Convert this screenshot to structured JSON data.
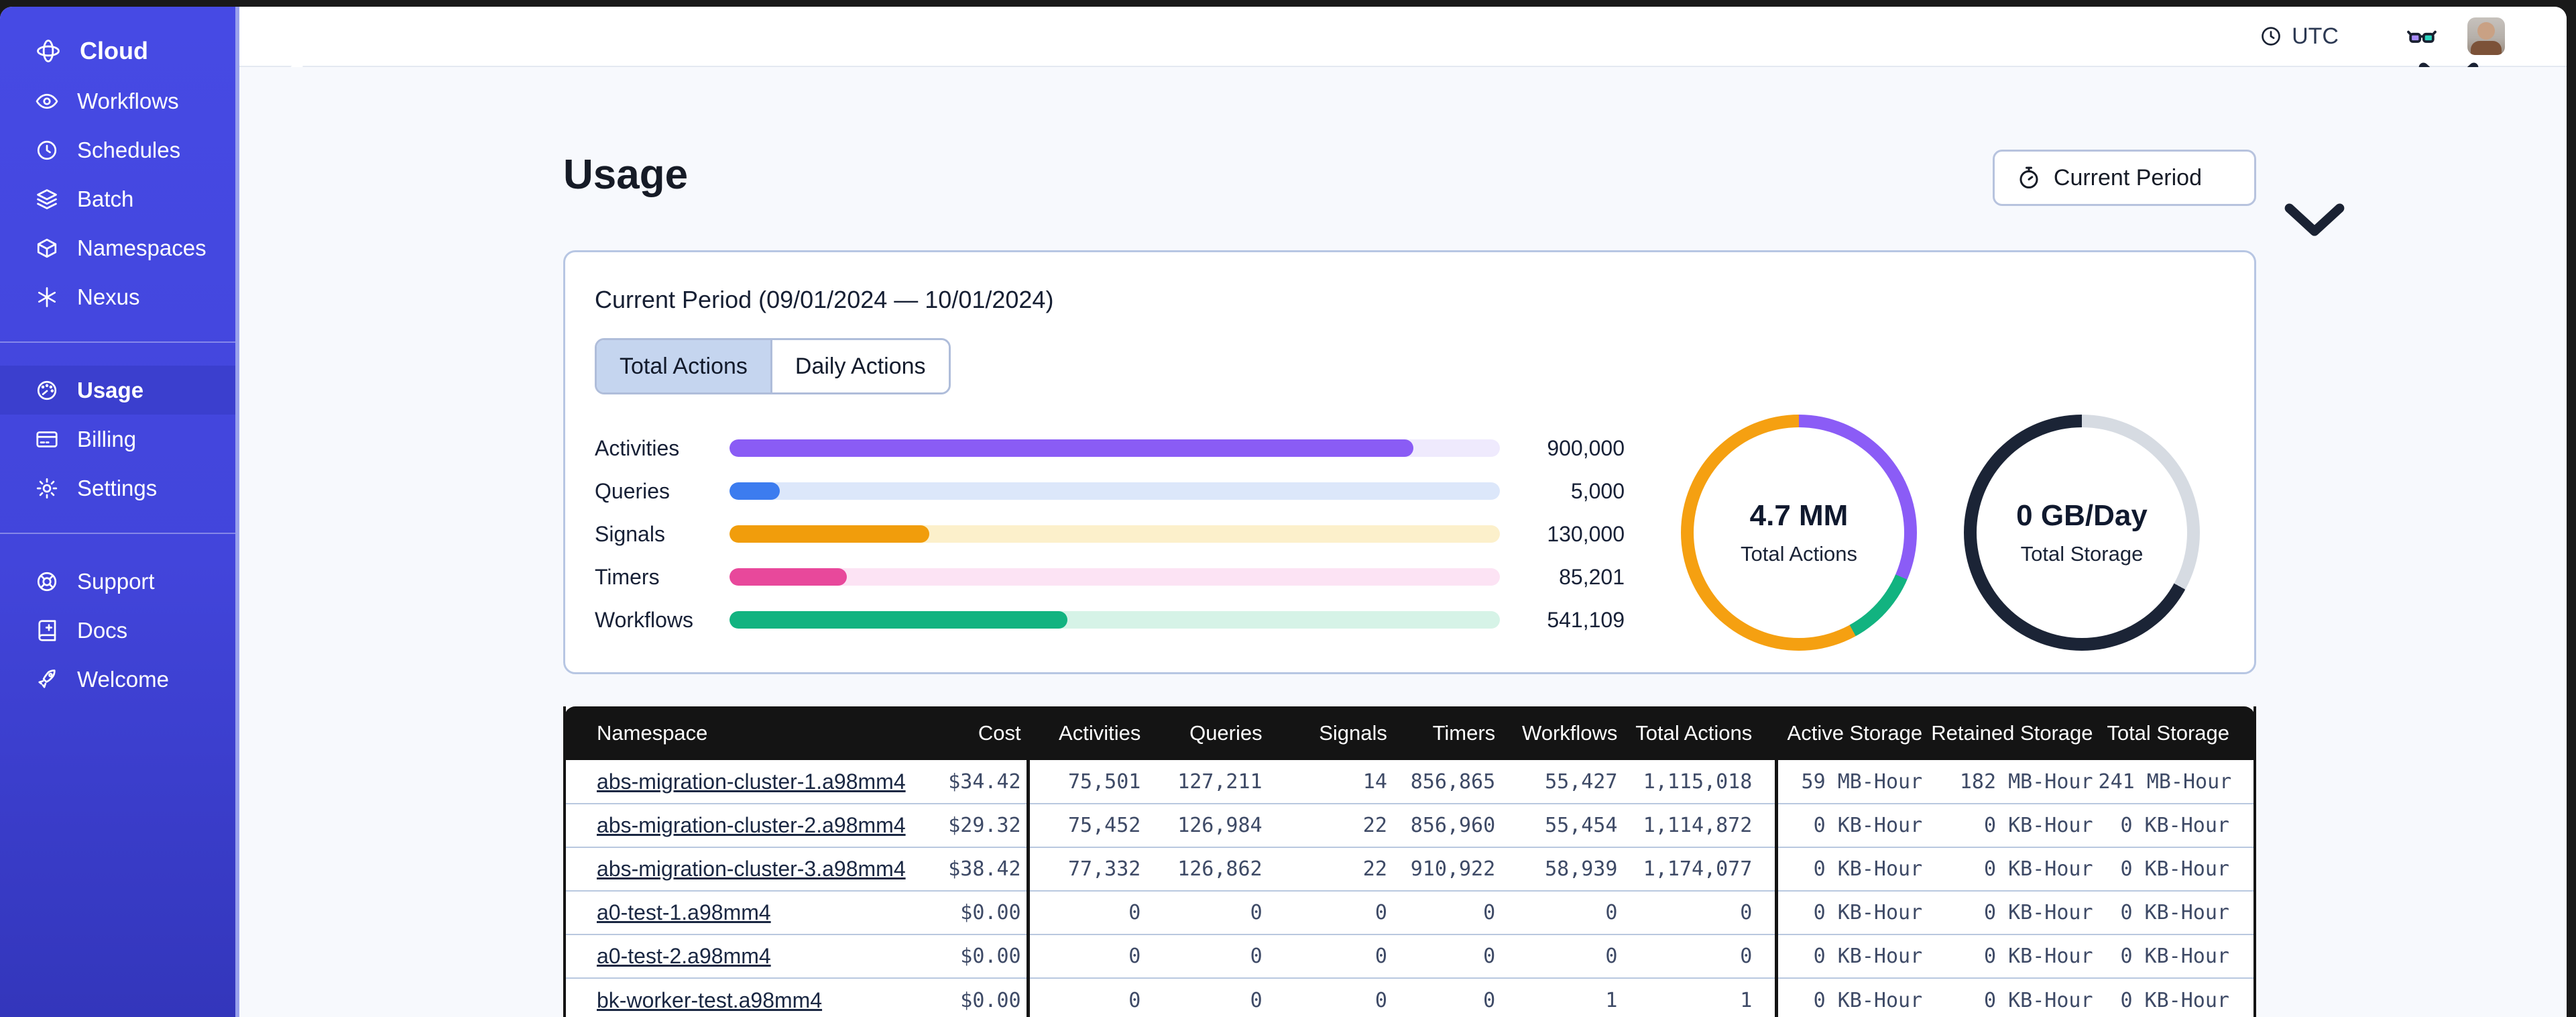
{
  "sidebar": {
    "brand": {
      "label": "Cloud"
    },
    "groups": [
      {
        "items": [
          {
            "name": "sidebar-item-workflows",
            "icon": "#i-workflows",
            "icon_name": "workflows-icon",
            "label": "Workflows",
            "active": false
          },
          {
            "name": "sidebar-item-schedules",
            "icon": "#i-schedules",
            "icon_name": "schedules-icon",
            "label": "Schedules",
            "active": false
          },
          {
            "name": "sidebar-item-batch",
            "icon": "#i-batch",
            "icon_name": "batch-icon",
            "label": "Batch",
            "active": false
          },
          {
            "name": "sidebar-item-namespaces",
            "icon": "#i-namespaces",
            "icon_name": "namespaces-icon",
            "label": "Namespaces",
            "active": false
          },
          {
            "name": "sidebar-item-nexus",
            "icon": "#i-nexus",
            "icon_name": "nexus-icon",
            "label": "Nexus",
            "active": false
          }
        ]
      },
      {
        "items": [
          {
            "name": "sidebar-item-usage",
            "icon": "#i-usage",
            "icon_name": "usage-gauge-icon",
            "label": "Usage",
            "active": true
          },
          {
            "name": "sidebar-item-billing",
            "icon": "#i-billing",
            "icon_name": "billing-card-icon",
            "label": "Billing",
            "active": false
          },
          {
            "name": "sidebar-item-settings",
            "icon": "#i-settings",
            "icon_name": "settings-gear-icon",
            "label": "Settings",
            "active": false
          }
        ]
      },
      {
        "items": [
          {
            "name": "sidebar-item-support",
            "icon": "#i-support",
            "icon_name": "support-lifebuoy-icon",
            "label": "Support",
            "active": false
          },
          {
            "name": "sidebar-item-docs",
            "icon": "#i-docs",
            "icon_name": "docs-book-icon",
            "label": "Docs",
            "active": false
          },
          {
            "name": "sidebar-item-welcome",
            "icon": "#i-welcome",
            "icon_name": "welcome-rocket-icon",
            "label": "Welcome",
            "active": false
          }
        ]
      }
    ]
  },
  "topbar": {
    "timezone": "UTC"
  },
  "page": {
    "title": "Usage",
    "period_button_label": "Current Period"
  },
  "usage_card": {
    "title": "Current Period (09/01/2024 — 10/01/2024)",
    "tabs": [
      {
        "name": "tab-total-actions",
        "label": "Total Actions",
        "active": true
      },
      {
        "name": "tab-daily-actions",
        "label": "Daily Actions",
        "active": false
      }
    ],
    "bars": [
      {
        "label": "Activities",
        "value": "900,000",
        "fraction": 0.888,
        "color": "#8A5CF5",
        "track": "#EFEAFD"
      },
      {
        "label": "Queries",
        "value": "5,000",
        "fraction": 0.065,
        "color": "#3C7CEF",
        "track": "#DCE7FA"
      },
      {
        "label": "Signals",
        "value": "130,000",
        "fraction": 0.259,
        "color": "#F19D0C",
        "track": "#FCF0CB"
      },
      {
        "label": "Timers",
        "value": "85,201",
        "fraction": 0.152,
        "color": "#E8489B",
        "track": "#FCE3F4"
      },
      {
        "label": "Workflows",
        "value": "541,109",
        "fraction": 0.439,
        "color": "#12B380",
        "track": "#D6F3E7"
      }
    ],
    "donuts": [
      {
        "name": "total-actions-donut",
        "value": "4.7 MM",
        "label": "Total Actions",
        "segments": [
          {
            "color": "#8B5CF6",
            "pct": 31.5
          },
          {
            "color": "#12B380",
            "pct": 10.5
          },
          {
            "color": "#F5A011",
            "pct": 58
          }
        ]
      },
      {
        "name": "total-storage-donut",
        "value": "0 GB/Day",
        "label": "Total Storage",
        "segments": [
          {
            "color": "#D6DBE2",
            "pct": 33
          },
          {
            "color": "#1B2436",
            "pct": 67
          }
        ]
      }
    ]
  },
  "table": {
    "columns": [
      "Namespace",
      "Cost",
      "Activities",
      "Queries",
      "Signals",
      "Timers",
      "Workflows",
      "Total Actions",
      "Active Storage",
      "Retained Storage",
      "Total Storage"
    ],
    "rows": [
      {
        "namespace": "abs-migration-cluster-1.a98mm4",
        "cost": "$34.42",
        "activities": "75,501",
        "queries": "127,211",
        "signals": "14",
        "timers": "856,865",
        "workflows": "55,427",
        "total_actions": "1,115,018",
        "active_storage": "59 MB-Hour",
        "retained_storage": "182 MB-Hour",
        "total_storage": "241 MB-Hour"
      },
      {
        "namespace": "abs-migration-cluster-2.a98mm4",
        "cost": "$29.32",
        "activities": "75,452",
        "queries": "126,984",
        "signals": "22",
        "timers": "856,960",
        "workflows": "55,454",
        "total_actions": "1,114,872",
        "active_storage": "0 KB-Hour",
        "retained_storage": "0 KB-Hour",
        "total_storage": "0 KB-Hour"
      },
      {
        "namespace": "abs-migration-cluster-3.a98mm4",
        "cost": "$38.42",
        "activities": "77,332",
        "queries": "126,862",
        "signals": "22",
        "timers": "910,922",
        "workflows": "58,939",
        "total_actions": "1,174,077",
        "active_storage": "0 KB-Hour",
        "retained_storage": "0 KB-Hour",
        "total_storage": "0 KB-Hour"
      },
      {
        "namespace": "a0-test-1.a98mm4",
        "cost": "$0.00",
        "activities": "0",
        "queries": "0",
        "signals": "0",
        "timers": "0",
        "workflows": "0",
        "total_actions": "0",
        "active_storage": "0 KB-Hour",
        "retained_storage": "0 KB-Hour",
        "total_storage": "0 KB-Hour"
      },
      {
        "namespace": "a0-test-2.a98mm4",
        "cost": "$0.00",
        "activities": "0",
        "queries": "0",
        "signals": "0",
        "timers": "0",
        "workflows": "0",
        "total_actions": "0",
        "active_storage": "0 KB-Hour",
        "retained_storage": "0 KB-Hour",
        "total_storage": "0 KB-Hour"
      },
      {
        "namespace": "bk-worker-test.a98mm4",
        "cost": "$0.00",
        "activities": "0",
        "queries": "0",
        "signals": "0",
        "timers": "0",
        "workflows": "1",
        "total_actions": "1",
        "active_storage": "0 KB-Hour",
        "retained_storage": "0 KB-Hour",
        "total_storage": "0 KB-Hour"
      }
    ]
  }
}
